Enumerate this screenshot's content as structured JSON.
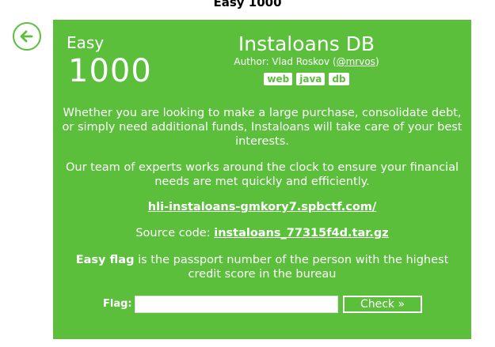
{
  "page": {
    "heading": "Easy 1000"
  },
  "back": {
    "icon": "arrow-left-icon"
  },
  "task": {
    "level": "Easy",
    "points": "1000",
    "title": "Instaloans DB",
    "author_prefix": "Author: Vlad Roskov (",
    "author_handle": "@mrvos",
    "author_suffix": ")",
    "tags": [
      "web",
      "java",
      "db"
    ],
    "description_1": "Whether you are looking to make a large purchase, consolidate debt, or simply need additional funds, Instaloans will take care of your best interests.",
    "description_2": "Our team of experts works around the clock to ensure your financial needs are met quickly and efficiently.",
    "service_url": "hli-instaloans-gmkory7.spbctf.com/",
    "source_label": "Source code: ",
    "source_file": "instaloans_77315f4d.tar.gz",
    "flag_desc_bold": "Easy flag",
    "flag_desc_rest": " is the passport number of the person with the highest credit score in the bureau"
  },
  "form": {
    "flag_label": "Flag:",
    "flag_value": "",
    "check_label": "Check »"
  },
  "colors": {
    "accent": "#5bbf3c",
    "text": "#ffffff"
  }
}
